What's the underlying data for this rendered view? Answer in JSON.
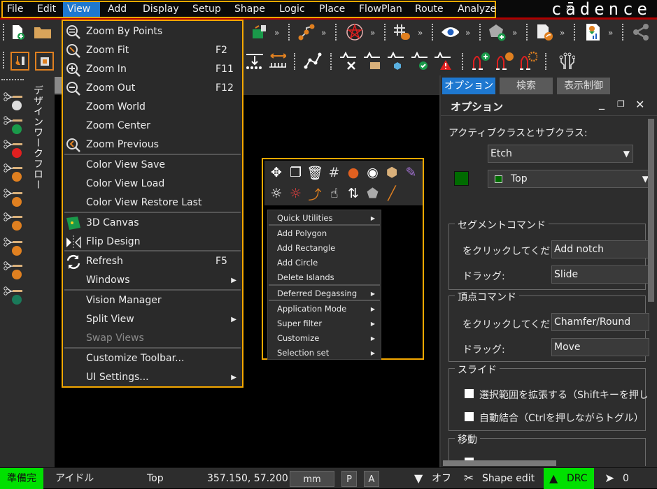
{
  "menubar": {
    "items": [
      "File",
      "Edit",
      "View",
      "Add",
      "Display",
      "Setup",
      "Shape",
      "Logic",
      "Place",
      "FlowPlan",
      "Route",
      "Analyze"
    ],
    "active": "View",
    "overflow": "»",
    "logo": "cādence"
  },
  "colors": {
    "highlight": "#f5a800",
    "menu_active": "#1e78d0",
    "status_ready": "#00e000",
    "drc_ok": "#00e000",
    "subclass_swatch": "#006b00"
  },
  "toolbar": {
    "row1": [
      "new-design-icon",
      "open-folder-icon",
      "place-component-icon",
      "route-connect-icon",
      "ratsnest-icon",
      "grid-snap-icon",
      "visibility-eye-icon",
      "add-shape-icon",
      "report-export-icon",
      "report-chart-icon",
      "share-icon"
    ],
    "row2": [
      "workflow-component-icon",
      "chip-select-icon",
      "align-distribute-icon",
      "measure-icon",
      "route-line-icon",
      "signal-tools-icon",
      "signal-library-icon",
      "signal-3d-icon",
      "signal-check-icon",
      "signal-warning-icon",
      "diff-pair-add-icon",
      "diff-pair-edit-icon",
      "diff-pair-settings-icon",
      "fanout-icon"
    ],
    "more": "»"
  },
  "leftbar": {
    "title": "デザインワークフロー",
    "items": [
      "workflow-settings-icon",
      "workflow-add-icon",
      "workflow-delete-icon",
      "workflow-edit-icon",
      "workflow-branch-icon",
      "workflow-list-icon",
      "workflow-connect-icon",
      "workflow-toggle-icon",
      "workflow-run-icon"
    ]
  },
  "view_menu": {
    "items": [
      {
        "label": "Zoom By Points",
        "shortcut": "",
        "icon": "zoom-by-points-icon"
      },
      {
        "label": "Zoom Fit",
        "shortcut": "F2",
        "icon": "zoom-fit-icon"
      },
      {
        "label": "Zoom In",
        "shortcut": "F11",
        "icon": "zoom-in-icon"
      },
      {
        "label": "Zoom Out",
        "shortcut": "F12",
        "icon": "zoom-out-icon"
      },
      {
        "label": "Zoom World",
        "shortcut": ""
      },
      {
        "label": "Zoom Center",
        "shortcut": ""
      },
      {
        "label": "Zoom Previous",
        "shortcut": "",
        "icon": "zoom-previous-icon"
      },
      {
        "label": "Color View Save",
        "shortcut": ""
      },
      {
        "label": "Color View Load",
        "shortcut": ""
      },
      {
        "label": "Color View Restore Last",
        "shortcut": ""
      },
      {
        "label": "3D Canvas",
        "shortcut": "",
        "icon": "3d-canvas-icon"
      },
      {
        "label": "Flip Design",
        "shortcut": "",
        "icon": "flip-design-icon"
      },
      {
        "label": "Refresh",
        "shortcut": "F5",
        "icon": "refresh-icon"
      },
      {
        "label": "Windows",
        "submenu": true
      },
      {
        "label": "Vision Manager",
        "shortcut": ""
      },
      {
        "label": "Split View",
        "submenu": true
      },
      {
        "label": "Swap Views",
        "disabled": true
      },
      {
        "label": "Customize Toolbar...",
        "shortcut": ""
      },
      {
        "label": "UI Settings...",
        "submenu": true
      }
    ]
  },
  "popup": {
    "icons_row1": [
      "move-icon",
      "copy-icon",
      "delete-icon",
      "grid-icon",
      "color-wheel-icon",
      "eye-icon",
      "measure-3d-icon",
      "palette-icon"
    ],
    "icons_row2": [
      "highlight-icon",
      "dehighlight-icon",
      "route-icon",
      "touch-icon",
      "swap-icon",
      "add-shape-icon",
      "add-line-icon"
    ],
    "items": [
      {
        "label": "Quick Utilities",
        "submenu": true
      },
      {
        "label": "Add Polygon"
      },
      {
        "label": "Add Rectangle"
      },
      {
        "label": "Add Circle"
      },
      {
        "label": "Delete Islands"
      },
      {
        "label": "Deferred Degassing",
        "submenu": true
      },
      {
        "label": "Application Mode",
        "submenu": true
      },
      {
        "label": "Super filter",
        "submenu": true
      },
      {
        "label": "Customize",
        "submenu": true
      },
      {
        "label": "Selection set",
        "submenu": true
      }
    ]
  },
  "right_panel": {
    "tabs": [
      "オプション",
      "検索",
      "表示制御"
    ],
    "active_tab": "オプション",
    "title": "オプション",
    "class_label": "アクティブクラスとサブクラス:",
    "class_value": "Etch",
    "subclass_value": "Top",
    "segment_group": "セグメントコマンド",
    "segment_click_label": "をクリックしてください:",
    "segment_click_value": "Add notch",
    "segment_drag_label": "ドラッグ:",
    "segment_drag_value": "Slide",
    "vertex_group": "頂点コマンド",
    "vertex_click_label": "をクリックしてください:",
    "vertex_click_value": "Chamfer/Round",
    "vertex_drag_label": "ドラッグ:",
    "vertex_drag_value": "Move",
    "slide_group": "スライド",
    "slide_opt1": "選択範囲を拡張する（Shiftキーを押しなが",
    "slide_opt2": "自動結合（Ctrlを押しながらトグル）",
    "move_group": "移動"
  },
  "statusbar": {
    "ready": "準備完",
    "mode": "アイドル",
    "layer": "Top",
    "coords": "357.150, 57.200",
    "units": "mm",
    "p_btn": "P",
    "a_btn": "A",
    "filter": "オフ",
    "app_mode": "Shape edit",
    "drc": "DRC",
    "selection_count": "0"
  }
}
